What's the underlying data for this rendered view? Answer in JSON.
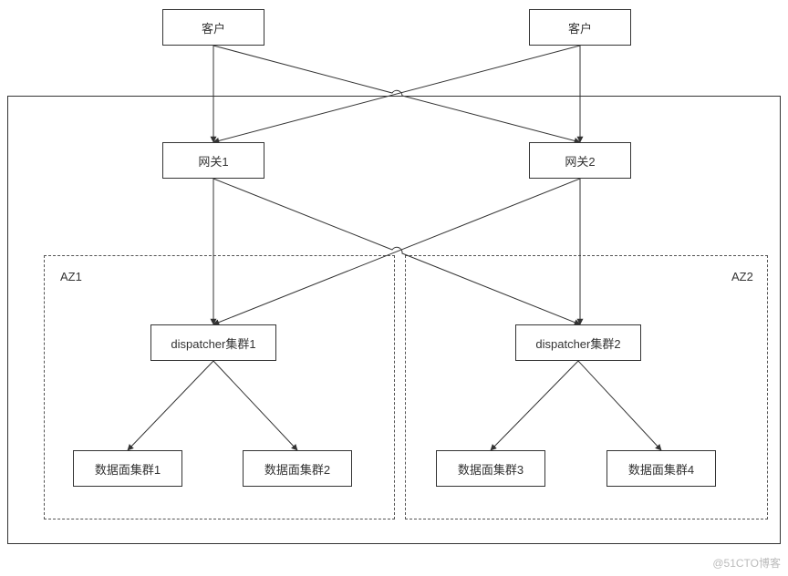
{
  "diagram": {
    "nodes": {
      "client_left": {
        "label": "客户"
      },
      "client_right": {
        "label": "客户"
      },
      "gateway1": {
        "label": "网关1"
      },
      "gateway2": {
        "label": "网关2"
      },
      "dispatcher1": {
        "label": "dispatcher集群1"
      },
      "dispatcher2": {
        "label": "dispatcher集群2"
      },
      "data1": {
        "label": "数据面集群1"
      },
      "data2": {
        "label": "数据面集群2"
      },
      "data3": {
        "label": "数据面集群3"
      },
      "data4": {
        "label": "数据面集群4"
      }
    },
    "regions": {
      "az1": {
        "label": "AZ1"
      },
      "az2": {
        "label": "AZ2"
      }
    },
    "edges": [
      {
        "from": "client_left",
        "to": "gateway1"
      },
      {
        "from": "client_left",
        "to": "gateway2"
      },
      {
        "from": "client_right",
        "to": "gateway1"
      },
      {
        "from": "client_right",
        "to": "gateway2"
      },
      {
        "from": "gateway1",
        "to": "dispatcher1"
      },
      {
        "from": "gateway1",
        "to": "dispatcher2"
      },
      {
        "from": "gateway2",
        "to": "dispatcher1"
      },
      {
        "from": "gateway2",
        "to": "dispatcher2"
      },
      {
        "from": "dispatcher1",
        "to": "data1"
      },
      {
        "from": "dispatcher1",
        "to": "data2"
      },
      {
        "from": "dispatcher2",
        "to": "data3"
      },
      {
        "from": "dispatcher2",
        "to": "data4"
      }
    ]
  },
  "watermark": "@51CTO博客"
}
